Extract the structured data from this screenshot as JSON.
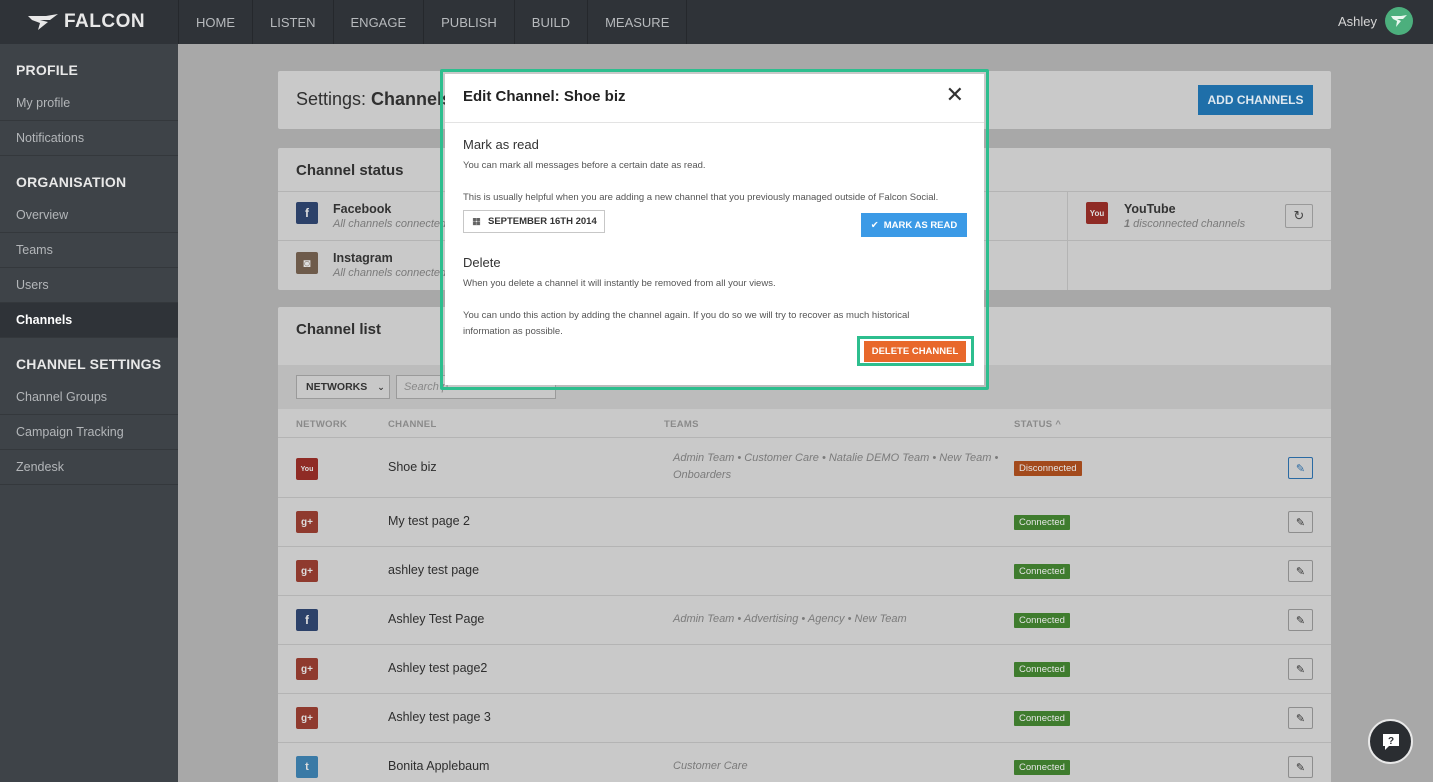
{
  "app": {
    "logo_text": "FALCON"
  },
  "topnav": {
    "items": [
      "HOME",
      "LISTEN",
      "ENGAGE",
      "PUBLISH",
      "BUILD",
      "MEASURE"
    ],
    "user_name": "Ashley"
  },
  "sidebar": {
    "sections": [
      {
        "heading": "PROFILE",
        "items": [
          "My profile",
          "Notifications"
        ]
      },
      {
        "heading": "ORGANISATION",
        "items": [
          "Overview",
          "Teams",
          "Users",
          "Channels"
        ]
      },
      {
        "heading": "CHANNEL SETTINGS",
        "items": [
          "Channel Groups",
          "Campaign Tracking",
          "Zendesk"
        ]
      }
    ],
    "active_item": "Channels"
  },
  "settings": {
    "prefix": "Settings: ",
    "title": "Channels",
    "add_button": "ADD CHANNELS"
  },
  "channel_status": {
    "title": "Channel status",
    "items": [
      {
        "name": "Facebook",
        "sub": "All channels connected",
        "icon": "facebook-icon"
      },
      {
        "name": "Instagram",
        "sub": "All channels connected",
        "icon": "instagram-icon"
      },
      {
        "name": "YouTube",
        "sub_count": "1",
        "sub": " disconnected channels",
        "icon": "youtube-icon"
      }
    ]
  },
  "channel_list": {
    "title": "Channel list",
    "networks_filter": "NETWORKS",
    "search_placeholder": "Search p",
    "headers": {
      "network": "NETWORK",
      "channel": "CHANNEL",
      "teams": "TEAMS",
      "status": "STATUS ^"
    },
    "rows": [
      {
        "network": "youtube",
        "name": "Shoe biz",
        "teams": "Admin Team • Customer Care • Natalie DEMO Team • New Team • Onboarders",
        "status": "Disconnected"
      },
      {
        "network": "google-plus",
        "name": "My test page 2",
        "teams": "",
        "status": "Connected"
      },
      {
        "network": "google-plus",
        "name": "ashley test page",
        "teams": "",
        "status": "Connected"
      },
      {
        "network": "facebook",
        "name": "Ashley Test Page",
        "teams": "Admin Team • Advertising • Agency • New Team",
        "status": "Connected"
      },
      {
        "network": "google-plus",
        "name": "Ashley test page2",
        "teams": "",
        "status": "Connected"
      },
      {
        "network": "google-plus",
        "name": "Ashley test page 3",
        "teams": "",
        "status": "Connected"
      },
      {
        "network": "twitter",
        "name": "Bonita Applebaum",
        "teams": "Customer Care",
        "status": "Connected"
      }
    ]
  },
  "modal": {
    "title": "Edit Channel: Shoe biz",
    "close": "✕",
    "mark_heading": "Mark as read",
    "mark_text_1": "You can mark all messages before a certain date as read.",
    "mark_text_2": "This is usually helpful when you are adding a new channel that you previously managed outside of Falcon Social.",
    "date_value": "SEPTEMBER 16TH 2014",
    "mark_button": "MARK AS READ",
    "delete_heading": "Delete",
    "delete_text_1": "When you delete a channel it will instantly be removed from all your views.",
    "delete_text_2": "You can undo this action by adding the channel again. If you do so we will try to recover as much historical information as possible.",
    "delete_button": "DELETE CHANNEL"
  },
  "colors": {
    "accent": "#2dbe8e",
    "primary": "#3b9ae6",
    "danger": "#e8682b"
  }
}
